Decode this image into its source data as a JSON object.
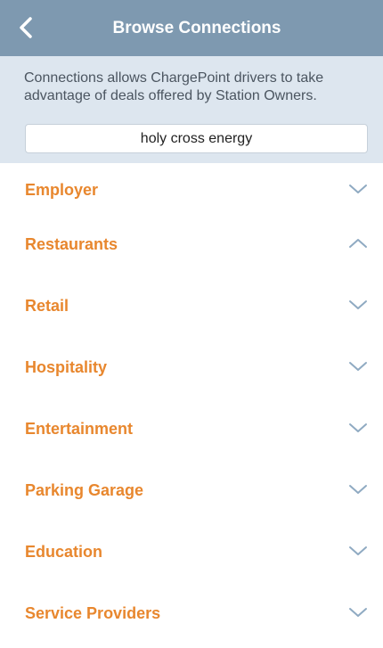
{
  "header": {
    "title": "Browse Connections",
    "back_icon": "chevron-left-icon",
    "background_color": "#7e99b0"
  },
  "intro": {
    "description": "Connections allows ChargePoint drivers to take advantage of deals offered by Station Owners.",
    "background_color": "#dde6ef"
  },
  "search": {
    "value": "holy cross energy"
  },
  "categories": {
    "accent_color": "#e8872e",
    "items": [
      {
        "label": "Employer",
        "expanded": false,
        "icon": "chevron-down-icon"
      },
      {
        "label": "Restaurants",
        "expanded": true,
        "icon": "chevron-up-icon"
      },
      {
        "label": "Retail",
        "expanded": false,
        "icon": "chevron-down-icon"
      },
      {
        "label": "Hospitality",
        "expanded": false,
        "icon": "chevron-down-icon"
      },
      {
        "label": "Entertainment",
        "expanded": false,
        "icon": "chevron-down-icon"
      },
      {
        "label": "Parking Garage",
        "expanded": false,
        "icon": "chevron-down-icon"
      },
      {
        "label": "Education",
        "expanded": false,
        "icon": "chevron-down-icon"
      },
      {
        "label": "Service Providers",
        "expanded": false,
        "icon": "chevron-down-icon"
      }
    ]
  }
}
